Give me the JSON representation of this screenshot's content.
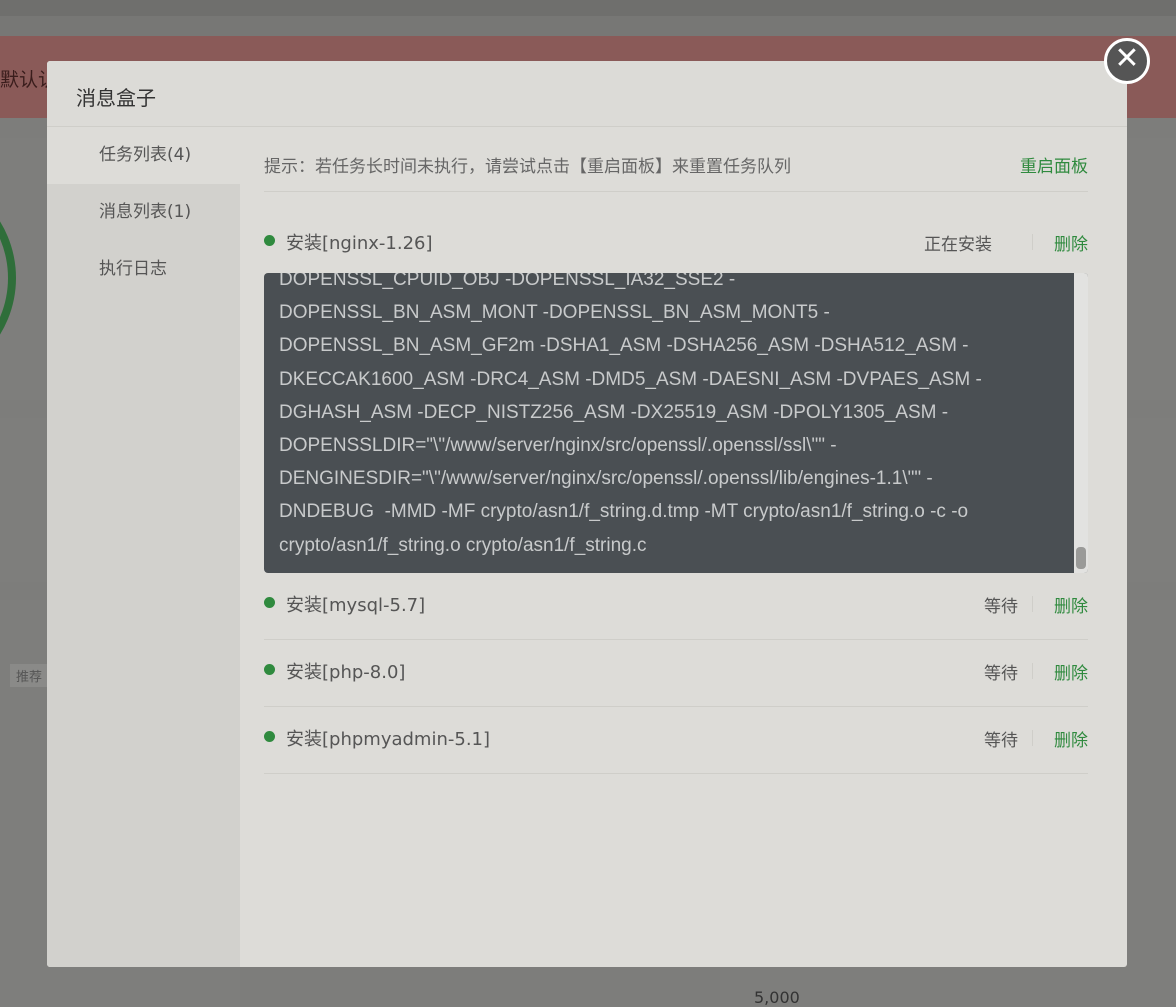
{
  "background": {
    "alert_text": "默认认",
    "tag_text": "推荐",
    "axis_value": "5,000"
  },
  "modal": {
    "title": "消息盒子",
    "close_symbol": "✕",
    "sidebar": [
      {
        "label": "任务列表(4)",
        "active": true
      },
      {
        "label": "消息列表(1)",
        "active": false
      },
      {
        "label": "执行日志",
        "active": false
      }
    ],
    "tip": "提示：若任务长时间未执行，请尝试点击【重启面板】来重置任务队列",
    "restart_label": "重启面板",
    "tasks": [
      {
        "name": "安装[nginx-1.26]",
        "status": "正在安装",
        "delete": "删除"
      },
      {
        "name": "安装[mysql-5.7]",
        "status": "等待",
        "delete": "删除"
      },
      {
        "name": "安装[php-8.0]",
        "status": "等待",
        "delete": "删除"
      },
      {
        "name": "安装[phpmyadmin-5.1]",
        "status": "等待",
        "delete": "删除"
      }
    ],
    "console_log": "DOPENSSL_CPUID_OBJ -DOPENSSL_IA32_SSE2 -\nDOPENSSL_BN_ASM_MONT -DOPENSSL_BN_ASM_MONT5 -\nDOPENSSL_BN_ASM_GF2m -DSHA1_ASM -DSHA256_ASM -DSHA512_ASM -\nDKECCAK1600_ASM -DRC4_ASM -DMD5_ASM -DAESNI_ASM -DVPAES_ASM -\nDGHASH_ASM -DECP_NISTZ256_ASM -DX25519_ASM -DPOLY1305_ASM -\nDOPENSSLDIR=\"\\\"/www/server/nginx/src/openssl/.openssl/ssl\\\"\" -\nDENGINESDIR=\"\\\"/www/server/nginx/src/openssl/.openssl/lib/engines-1.1\\\"\" -\nDNDEBUG  -MMD -MF crypto/asn1/f_string.d.tmp -MT crypto/asn1/f_string.o -c -o\ncrypto/asn1/f_string.o crypto/asn1/f_string.c"
  },
  "colors": {
    "accent_green": "#2f8a3e",
    "console_bg": "#4a4f53"
  }
}
